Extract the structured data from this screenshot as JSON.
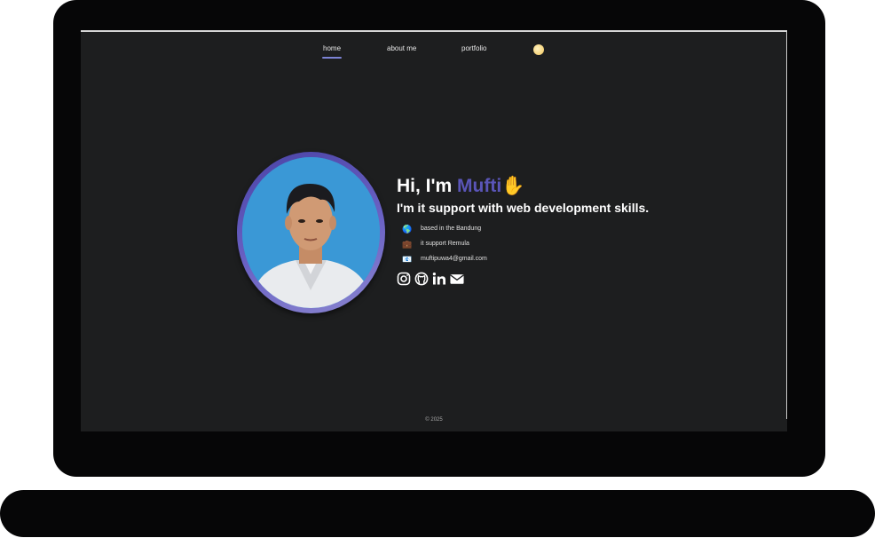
{
  "nav": {
    "items": [
      {
        "label": "home",
        "active": true
      },
      {
        "label": "about me",
        "active": false
      },
      {
        "label": "portfolio",
        "active": false
      }
    ],
    "theme_icon": "moon-icon"
  },
  "intro": {
    "greeting": "Hi, I'm ",
    "name": "Mufti",
    "wave": "✋",
    "tagline": "I'm it support with web development skills.",
    "info": [
      {
        "icon": "globe-icon",
        "emoji": "🌎",
        "text": "based in the Bandung"
      },
      {
        "icon": "briefcase-icon",
        "emoji": "💼",
        "text": "it support Remula"
      },
      {
        "icon": "email-card-icon",
        "emoji": "📧",
        "text": "muftipuwa4@gmail.com"
      }
    ],
    "socials": [
      "instagram-icon",
      "github-icon",
      "linkedin-icon",
      "mail-icon"
    ]
  },
  "colors": {
    "accent": "#5a55b8",
    "background": "#1d1e1f",
    "avatar_bg": "#3a98d6"
  },
  "footer": {
    "text": "© 2025"
  }
}
